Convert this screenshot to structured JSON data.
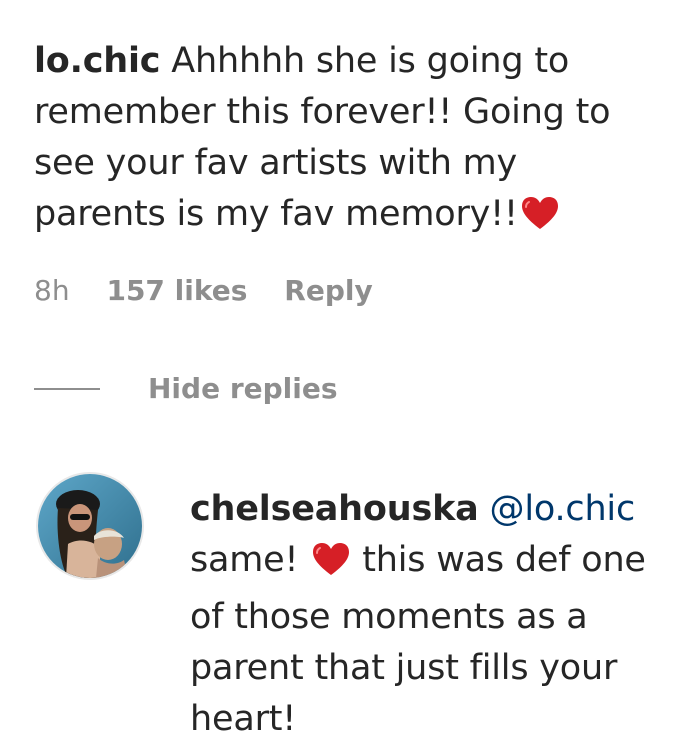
{
  "comment": {
    "username": "lo.chic",
    "text": "Ahhhhh she is going to remember this forever!! Going to see your fav artists with my parents is my fav memory!!",
    "time": "8h",
    "likes": "157 likes",
    "reply_label": "Reply"
  },
  "replies": {
    "hide_label": "Hide replies"
  },
  "reply": {
    "username": "chelseahouska",
    "mention": "@lo.chic",
    "text_before": "same!",
    "text_after": "this was def one of those moments as a parent that just fills your heart!"
  },
  "icons": {
    "heart": "red-heart-emoji",
    "avatar": "user-avatar"
  },
  "colors": {
    "text": "#262626",
    "meta": "#8e8e8e",
    "mention": "#00376b",
    "heart": "#d61f26"
  }
}
